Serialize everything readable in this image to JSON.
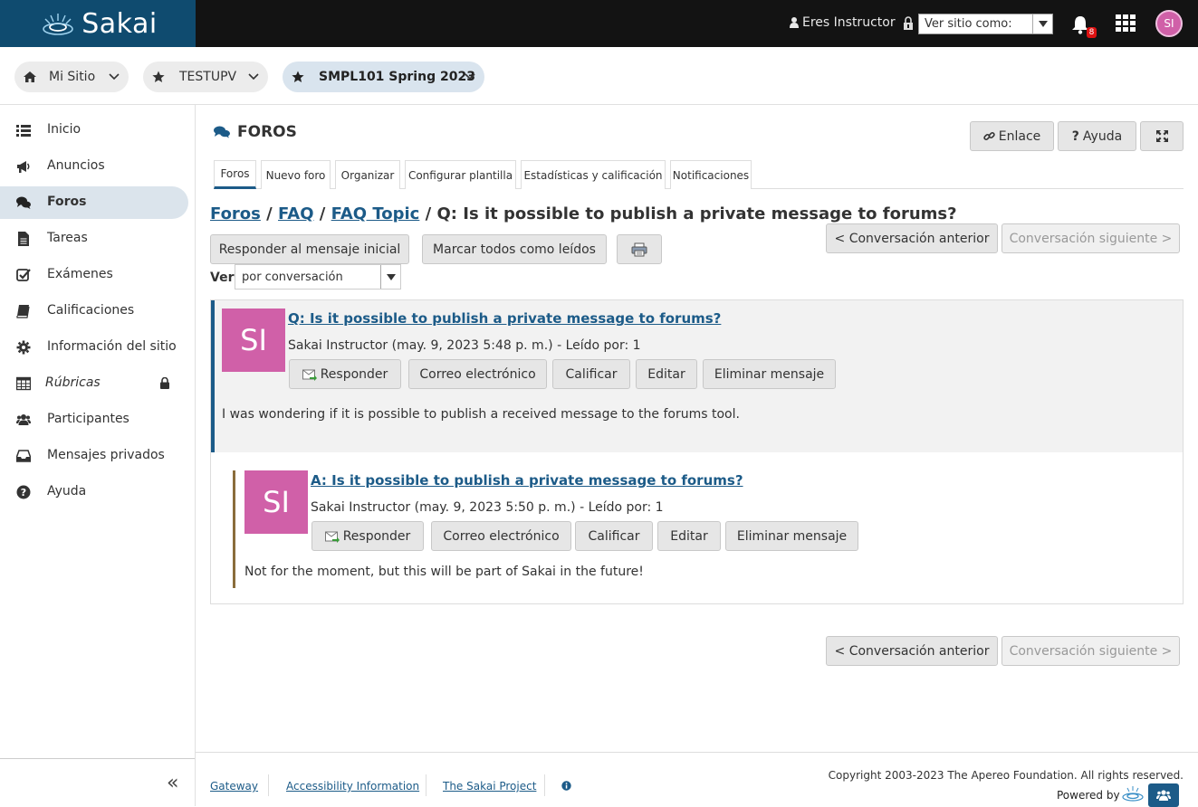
{
  "header": {
    "logo_text": "Sakai",
    "role_label": "Eres Instructor",
    "view_as_placeholder": "Ver sitio como:",
    "notification_count": "8",
    "avatar_initials": "SI"
  },
  "sites": [
    {
      "label": "Mi Sitio",
      "icon": "home-icon"
    },
    {
      "label": "TESTUPV",
      "icon": "star-icon"
    },
    {
      "label": "SMPL101 Spring 2023",
      "icon": "star-icon",
      "active": true
    }
  ],
  "sidebar": {
    "items": [
      {
        "label": "Inicio",
        "icon": "list-icon"
      },
      {
        "label": "Anuncios",
        "icon": "megaphone-icon"
      },
      {
        "label": "Foros",
        "icon": "comments-icon",
        "active": true
      },
      {
        "label": "Tareas",
        "icon": "file-icon"
      },
      {
        "label": "Exámenes",
        "icon": "checkbox-icon"
      },
      {
        "label": "Calificaciones",
        "icon": "book-icon"
      },
      {
        "label": "Información del sitio",
        "icon": "gear-icon"
      },
      {
        "label": "Rúbricas",
        "icon": "table-icon",
        "locked": true
      },
      {
        "label": "Participantes",
        "icon": "users-icon"
      },
      {
        "label": "Mensajes privados",
        "icon": "inbox-icon"
      },
      {
        "label": "Ayuda",
        "icon": "question-icon"
      }
    ],
    "collapse_glyph": "«"
  },
  "tool": {
    "title": "FOROS",
    "link_label": "Enlace",
    "help_label": "Ayuda",
    "tabs": [
      "Foros",
      "Nuevo foro",
      "Organizar",
      "Configurar plantilla",
      "Estadísticas y calificación",
      "Notificaciones"
    ]
  },
  "breadcrumb": {
    "forums": "Foros",
    "sep": "/",
    "faq": "FAQ",
    "topic": "FAQ Topic",
    "current": "Q: Is it possible to publish a private message to forums?"
  },
  "actions": {
    "reply_initial": "Responder al mensaje inicial",
    "mark_all_read": "Marcar todos como leídos",
    "prev_conversation": "< Conversación anterior",
    "next_conversation": "Conversación siguiente >"
  },
  "view": {
    "label": "Ver",
    "selected": "por conversación"
  },
  "messages": [
    {
      "initials": "SI",
      "title": "Q: Is it possible to publish a private message to forums?",
      "author": "Sakai Instructor",
      "date": "(may. 9, 2023 5:48 p. m.)",
      "read_by": "- Leído por: 1",
      "body": "I was wondering if it is possible to publish a received message to the forums tool."
    },
    {
      "initials": "SI",
      "title": "A: Is it possible to publish a private message to forums?",
      "author": "Sakai Instructor",
      "date": "(may. 9, 2023 5:50 p. m.)",
      "read_by": "- Leído por: 1",
      "body": "Not for the moment, but this will be part of Sakai in the future!"
    }
  ],
  "message_actions": {
    "reply": "Responder",
    "email": "Correo electrónico",
    "grade": "Calificar",
    "edit": "Editar",
    "delete": "Eliminar mensaje"
  },
  "footer": {
    "links": [
      "Gateway",
      "Accessibility Information",
      "The Sakai Project"
    ],
    "copyright": "Copyright 2003-2023 The Apereo Foundation. All rights reserved.",
    "powered_by": "Powered by"
  },
  "colors": {
    "brand": "#0f4b6f",
    "link": "#1c5b88",
    "avatar": "#d060a8",
    "topbar": "#131313"
  }
}
